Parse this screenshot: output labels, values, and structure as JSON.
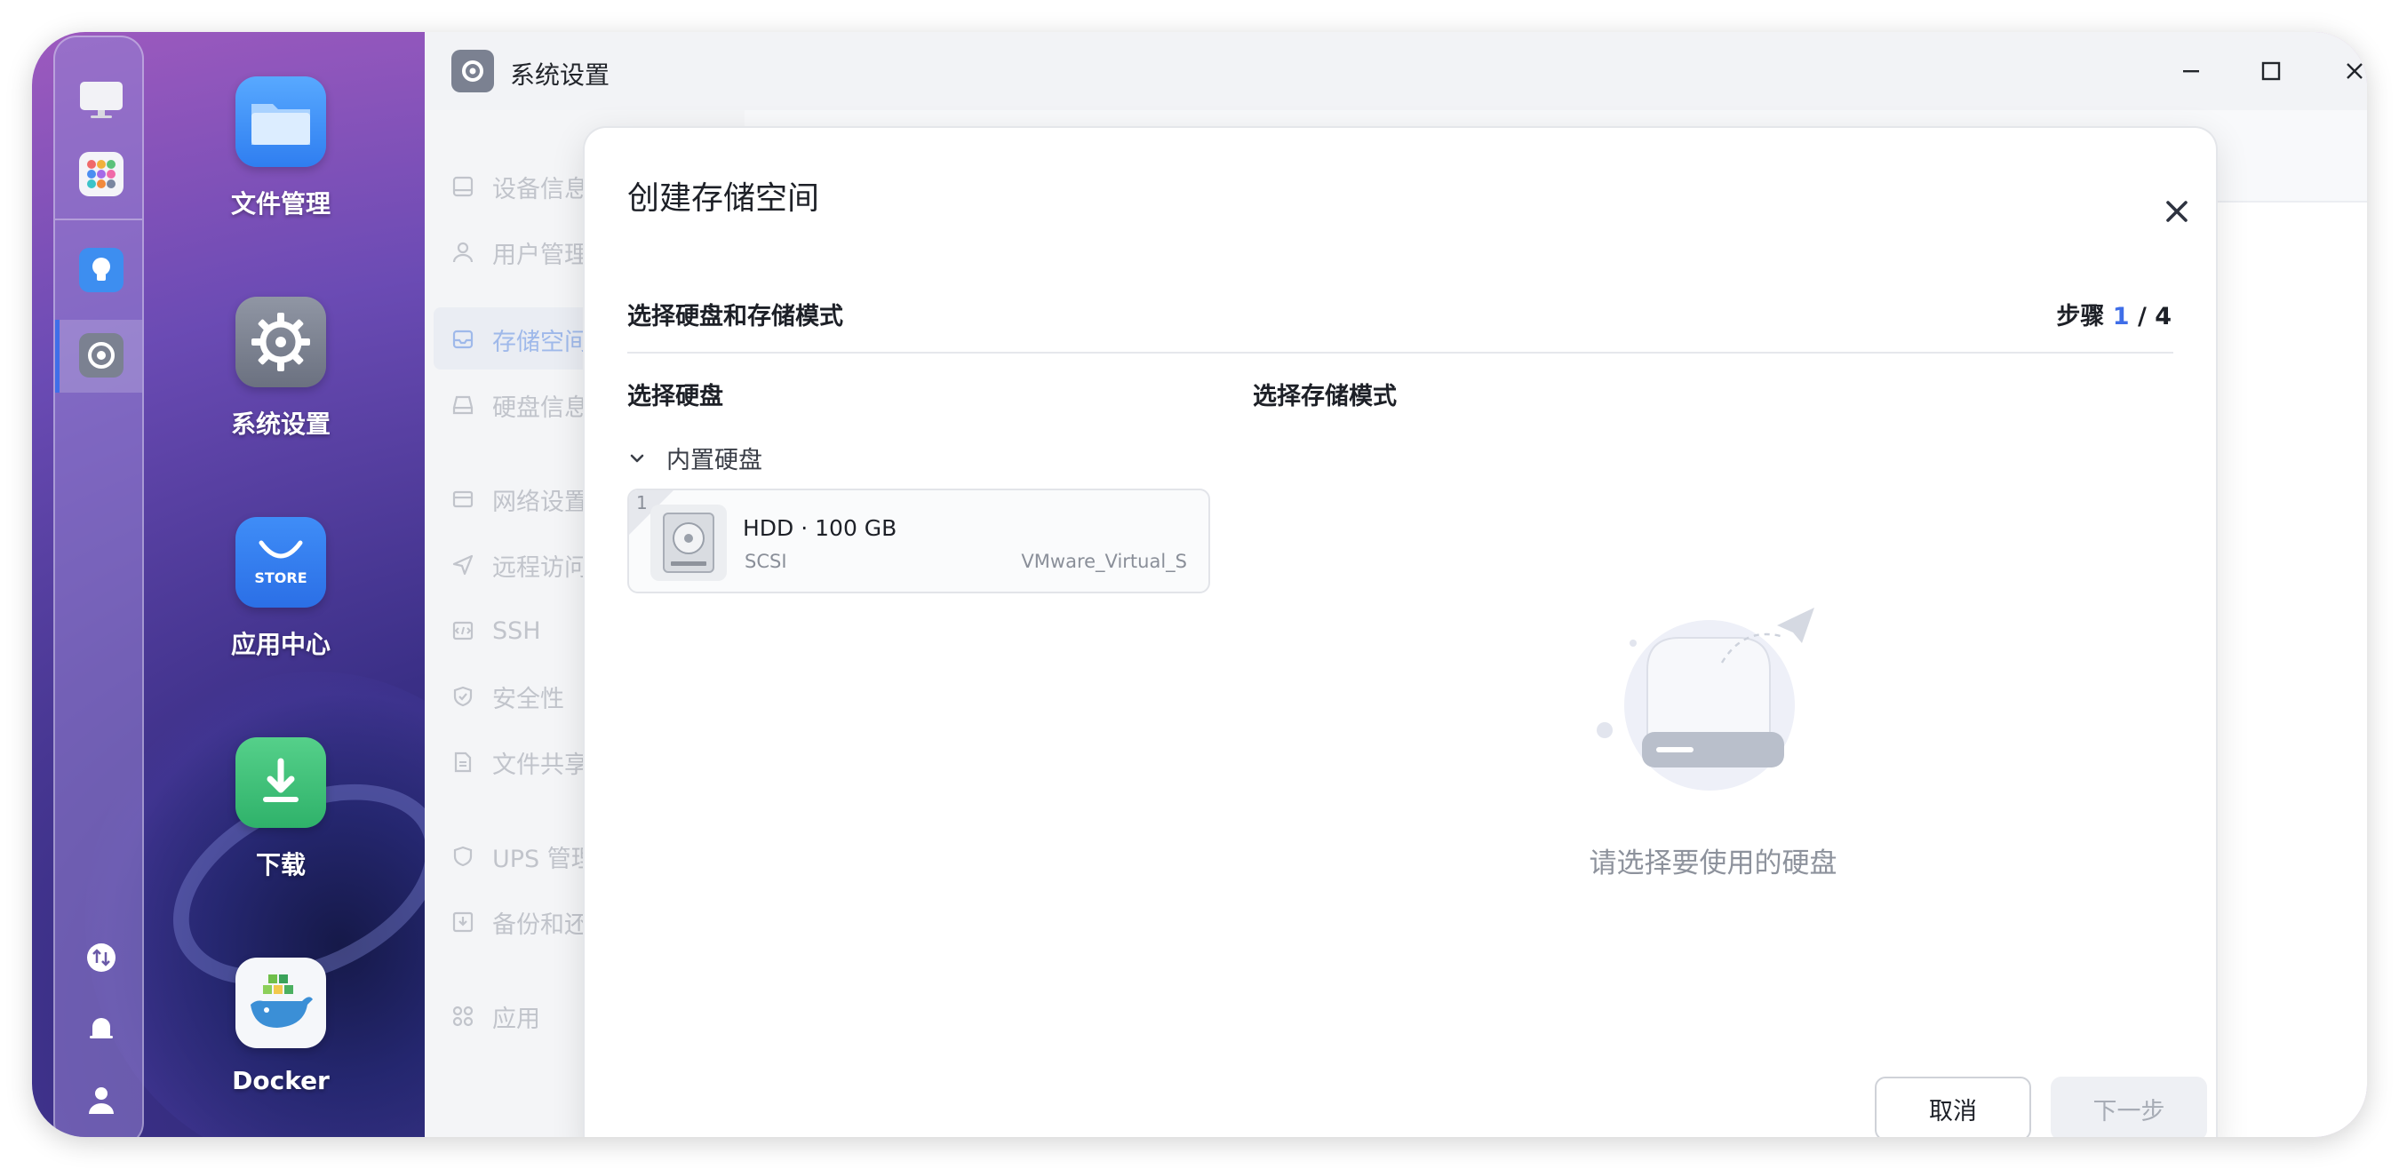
{
  "desktop": {
    "apps": [
      {
        "label": "文件管理",
        "icon": "folder-icon"
      },
      {
        "label": "系统设置",
        "icon": "gear-icon"
      },
      {
        "label": "应用中心",
        "icon": "store-icon",
        "badge": "STORE"
      },
      {
        "label": "下载",
        "icon": "download-icon"
      },
      {
        "label": "Docker",
        "icon": "docker-whale-icon"
      }
    ]
  },
  "dock": {
    "items": [
      "monitor-icon",
      "app-grid-icon",
      "lightbulb-icon",
      "settings-icon",
      "transfer-icon",
      "bell-icon",
      "user-icon"
    ],
    "active": "settings-icon"
  },
  "window": {
    "title": "系统设置",
    "sidebar": [
      {
        "label": "设备信息",
        "icon": "device-icon"
      },
      {
        "label": "用户管理",
        "icon": "user-icon"
      },
      {
        "label": "存储空间",
        "icon": "storage-icon",
        "active": true
      },
      {
        "label": "硬盘信息",
        "icon": "disk-icon"
      },
      {
        "label": "网络设置",
        "icon": "network-icon"
      },
      {
        "label": "远程访问",
        "icon": "send-icon"
      },
      {
        "label": "SSH",
        "icon": "code-icon"
      },
      {
        "label": "安全性",
        "icon": "shield-check-icon"
      },
      {
        "label": "文件共享",
        "icon": "file-share-icon"
      },
      {
        "label": "UPS 管理",
        "icon": "shield-icon"
      },
      {
        "label": "备份和还原",
        "icon": "backup-icon"
      },
      {
        "label": "应用",
        "icon": "apps-icon"
      }
    ]
  },
  "modal": {
    "title": "创建存储空间",
    "subtitle": "选择硬盘和存储模式",
    "step_label": "步骤",
    "step_current": "1",
    "step_total": "/ 4",
    "disk_section": "选择硬盘",
    "mode_section": "选择存储模式",
    "group_label": "内置硬盘",
    "disks": [
      {
        "index": "1",
        "name": "HDD · 100 GB",
        "type": "SCSI",
        "model": "VMware_Virtual_S"
      }
    ],
    "empty_text": "请选择要使用的硬盘",
    "cancel_label": "取消",
    "next_label": "下一步"
  },
  "colors": {
    "accent": "#3f6ee8",
    "disabled_text": "#a7acb5",
    "sidebar_disabled": "#c1c4cb"
  }
}
